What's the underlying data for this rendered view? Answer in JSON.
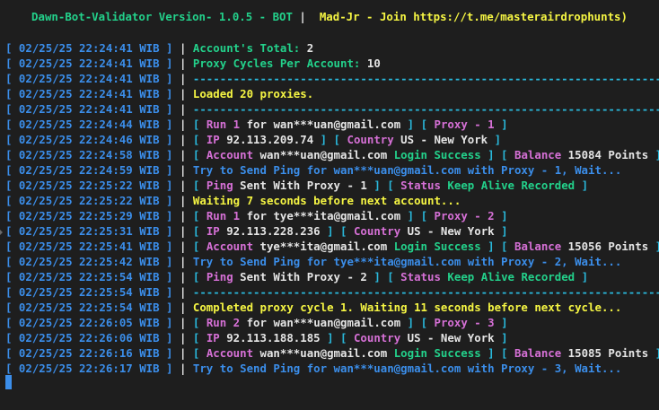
{
  "colors": {
    "background": "#1e1e1e",
    "timestamp": "#3b8eea",
    "cyan": "#29b8db",
    "green": "#23d18b",
    "yellow": "#f5f543",
    "white": "#e5e5e5",
    "blue": "#3b8eea",
    "magenta": "#d670d6"
  },
  "banner": {
    "title": "Dawn-Bot-Validator Version- 1.0.5 - BOT",
    "sep": " |  ",
    "author": "Mad-Jr - Join https://t.me/masterairdrophunts)"
  },
  "lines": [
    {
      "ts": "[ 02/25/25 22:24:41 WIB ]",
      "segs": [
        {
          "t": "Account's Total: ",
          "c": "green"
        },
        {
          "t": "2",
          "c": "white"
        }
      ]
    },
    {
      "ts": "[ 02/25/25 22:24:41 WIB ]",
      "segs": [
        {
          "t": "Proxy Cycles Per Account: ",
          "c": "green"
        },
        {
          "t": "10",
          "c": "white"
        }
      ]
    },
    {
      "ts": "[ 02/25/25 22:24:41 WIB ]",
      "segs": [
        {
          "t": "-------------------------------------------------------------------------",
          "c": "cyan"
        }
      ]
    },
    {
      "ts": "[ 02/25/25 22:24:41 WIB ]",
      "segs": [
        {
          "t": "Loaded 20 proxies.",
          "c": "yellow"
        }
      ]
    },
    {
      "ts": "[ 02/25/25 22:24:41 WIB ]",
      "segs": [
        {
          "t": "-------------------------------------------------------------------------",
          "c": "cyan"
        }
      ]
    },
    {
      "ts": "[ 02/25/25 22:24:44 WIB ]",
      "segs": [
        {
          "t": "[ ",
          "c": "cyan"
        },
        {
          "t": "Run 1",
          "c": "magenta"
        },
        {
          "t": " for ",
          "c": "white"
        },
        {
          "t": "wan***uan@gmail.com",
          "c": "white"
        },
        {
          "t": " ] [ ",
          "c": "cyan"
        },
        {
          "t": "Proxy - 1",
          "c": "magenta"
        },
        {
          "t": " ]",
          "c": "cyan"
        }
      ]
    },
    {
      "ts": "[ 02/25/25 22:24:46 WIB ]",
      "segs": [
        {
          "t": "[ ",
          "c": "cyan"
        },
        {
          "t": "IP",
          "c": "magenta"
        },
        {
          "t": " 92.113.209.74",
          "c": "white"
        },
        {
          "t": " ] [ ",
          "c": "cyan"
        },
        {
          "t": "Country",
          "c": "magenta"
        },
        {
          "t": " US - New York",
          "c": "white"
        },
        {
          "t": " ]",
          "c": "cyan"
        }
      ]
    },
    {
      "ts": "[ 02/25/25 22:24:58 WIB ]",
      "segs": [
        {
          "t": "[ ",
          "c": "cyan"
        },
        {
          "t": "Account",
          "c": "magenta"
        },
        {
          "t": " wan***uan@gmail.com ",
          "c": "white"
        },
        {
          "t": "Login Success",
          "c": "green"
        },
        {
          "t": " ] [ ",
          "c": "cyan"
        },
        {
          "t": "Balance",
          "c": "magenta"
        },
        {
          "t": " 15084 Points",
          "c": "white"
        },
        {
          "t": " ]",
          "c": "cyan"
        }
      ]
    },
    {
      "ts": "[ 02/25/25 22:24:59 WIB ]",
      "segs": [
        {
          "t": "Try to Send Ping for wan***uan@gmail.com with Proxy - 1, Wait...",
          "c": "blue"
        }
      ]
    },
    {
      "ts": "[ 02/25/25 22:25:22 WIB ]",
      "segs": [
        {
          "t": "[ ",
          "c": "cyan"
        },
        {
          "t": "Ping",
          "c": "magenta"
        },
        {
          "t": " Sent With Proxy - 1",
          "c": "white"
        },
        {
          "t": " ] [ ",
          "c": "cyan"
        },
        {
          "t": "Status",
          "c": "magenta"
        },
        {
          "t": " Keep Alive Recorded",
          "c": "green"
        },
        {
          "t": " ]",
          "c": "cyan"
        }
      ]
    },
    {
      "ts": "[ 02/25/25 22:25:22 WIB ]",
      "segs": [
        {
          "t": "Waiting 7 seconds before next account...",
          "c": "yellow"
        }
      ]
    },
    {
      "ts": "[ 02/25/25 22:25:29 WIB ]",
      "segs": [
        {
          "t": "[ ",
          "c": "cyan"
        },
        {
          "t": "Run 1",
          "c": "magenta"
        },
        {
          "t": " for ",
          "c": "white"
        },
        {
          "t": "tye***ita@gmail.com",
          "c": "white"
        },
        {
          "t": " ] [ ",
          "c": "cyan"
        },
        {
          "t": "Proxy - 2",
          "c": "magenta"
        },
        {
          "t": " ]",
          "c": "cyan"
        }
      ]
    },
    {
      "ts": "[ 02/25/25 22:25:31 WIB ]",
      "segs": [
        {
          "t": "[ ",
          "c": "cyan"
        },
        {
          "t": "IP",
          "c": "magenta"
        },
        {
          "t": " 92.113.228.236",
          "c": "white"
        },
        {
          "t": " ] [ ",
          "c": "cyan"
        },
        {
          "t": "Country",
          "c": "magenta"
        },
        {
          "t": " US - New York",
          "c": "white"
        },
        {
          "t": " ]",
          "c": "cyan"
        }
      ]
    },
    {
      "ts": "[ 02/25/25 22:25:41 WIB ]",
      "segs": [
        {
          "t": "[ ",
          "c": "cyan"
        },
        {
          "t": "Account",
          "c": "magenta"
        },
        {
          "t": " tye***ita@gmail.com ",
          "c": "white"
        },
        {
          "t": "Login Success",
          "c": "green"
        },
        {
          "t": " ] [ ",
          "c": "cyan"
        },
        {
          "t": "Balance",
          "c": "magenta"
        },
        {
          "t": " 15056 Points",
          "c": "white"
        },
        {
          "t": " ]",
          "c": "cyan"
        }
      ]
    },
    {
      "ts": "[ 02/25/25 22:25:42 WIB ]",
      "segs": [
        {
          "t": "Try to Send Ping for tye***ita@gmail.com with Proxy - 2, Wait...",
          "c": "blue"
        }
      ]
    },
    {
      "ts": "[ 02/25/25 22:25:54 WIB ]",
      "segs": [
        {
          "t": "[ ",
          "c": "cyan"
        },
        {
          "t": "Ping",
          "c": "magenta"
        },
        {
          "t": " Sent With Proxy - 2",
          "c": "white"
        },
        {
          "t": " ] [ ",
          "c": "cyan"
        },
        {
          "t": "Status",
          "c": "magenta"
        },
        {
          "t": " Keep Alive Recorded",
          "c": "green"
        },
        {
          "t": " ]",
          "c": "cyan"
        }
      ]
    },
    {
      "ts": "[ 02/25/25 22:25:54 WIB ]",
      "segs": [
        {
          "t": "-------------------------------------------------------------------------",
          "c": "cyan"
        }
      ]
    },
    {
      "ts": "[ 02/25/25 22:25:54 WIB ]",
      "segs": [
        {
          "t": "Completed proxy cycle 1. Waiting 11 seconds before next cycle...",
          "c": "yellow"
        }
      ]
    },
    {
      "ts": "[ 02/25/25 22:26:05 WIB ]",
      "segs": [
        {
          "t": "[ ",
          "c": "cyan"
        },
        {
          "t": "Run 2",
          "c": "magenta"
        },
        {
          "t": " for ",
          "c": "white"
        },
        {
          "t": "wan***uan@gmail.com",
          "c": "white"
        },
        {
          "t": " ] [ ",
          "c": "cyan"
        },
        {
          "t": "Proxy - 3",
          "c": "magenta"
        },
        {
          "t": " ]",
          "c": "cyan"
        }
      ]
    },
    {
      "ts": "[ 02/25/25 22:26:06 WIB ]",
      "segs": [
        {
          "t": "[ ",
          "c": "cyan"
        },
        {
          "t": "IP",
          "c": "magenta"
        },
        {
          "t": " 92.113.188.185",
          "c": "white"
        },
        {
          "t": " ] [ ",
          "c": "cyan"
        },
        {
          "t": "Country",
          "c": "magenta"
        },
        {
          "t": " US - New York",
          "c": "white"
        },
        {
          "t": " ]",
          "c": "cyan"
        }
      ]
    },
    {
      "ts": "[ 02/25/25 22:26:16 WIB ]",
      "segs": [
        {
          "t": "[ ",
          "c": "cyan"
        },
        {
          "t": "Account",
          "c": "magenta"
        },
        {
          "t": " wan***uan@gmail.com ",
          "c": "white"
        },
        {
          "t": "Login Success",
          "c": "green"
        },
        {
          "t": " ] [ ",
          "c": "cyan"
        },
        {
          "t": "Balance",
          "c": "magenta"
        },
        {
          "t": " 15085 Points",
          "c": "white"
        },
        {
          "t": " ]",
          "c": "cyan"
        }
      ]
    },
    {
      "ts": "[ 02/25/25 22:26:17 WIB ]",
      "segs": [
        {
          "t": "Try to Send Ping for wan***uan@gmail.com with Proxy - 3, Wait...",
          "c": "blue"
        }
      ]
    }
  ]
}
